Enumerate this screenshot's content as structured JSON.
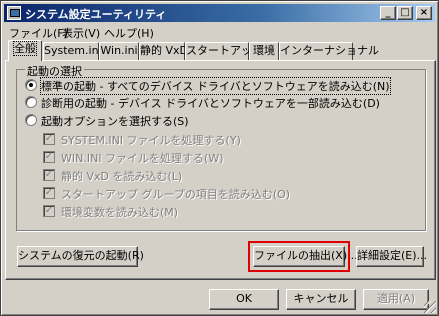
{
  "window": {
    "title": "システム設定ユーティリティ",
    "caption_buttons": {
      "minimize": "_",
      "maximize": "□",
      "close": "×"
    }
  },
  "menubar": [
    {
      "label": "ファイル(F)"
    },
    {
      "label": "表示(V)"
    },
    {
      "label": "ヘルプ(H)"
    }
  ],
  "tabs": [
    {
      "label": "全般",
      "active": true
    },
    {
      "label": "System.ini",
      "active": false
    },
    {
      "label": "Win.ini",
      "active": false
    },
    {
      "label": "静的 VxD",
      "active": false
    },
    {
      "label": "スタートアップ",
      "active": false
    },
    {
      "label": "環境",
      "active": false
    },
    {
      "label": "インターナショナル",
      "active": false
    }
  ],
  "startup_group": {
    "legend": "起動の選択",
    "options": [
      {
        "label": "標準の起動 - すべてのデバイス ドライバとソフトウェアを読み込む(N)",
        "checked": true
      },
      {
        "label": "診断用の起動 - デバイス ドライバとソフトウェアを一部読み込む(D)",
        "checked": false
      },
      {
        "label": "起動オプションを選択する(S)",
        "checked": false
      }
    ],
    "checkboxes": [
      {
        "label": "SYSTEM.INI ファイルを処理する(Y)",
        "checked": true,
        "enabled": false
      },
      {
        "label": "WIN.INI ファイルを処理する(W)",
        "checked": true,
        "enabled": false
      },
      {
        "label": "静的 VxD を読み込む(L)",
        "checked": true,
        "enabled": false
      },
      {
        "label": "スタートアップ グループの項目を読み込む(O)",
        "checked": true,
        "enabled": false
      },
      {
        "label": "環境変数を読み込む(M)",
        "checked": true,
        "enabled": false
      }
    ]
  },
  "panel_buttons": {
    "restore": "システムの復元の起動(R)",
    "extract": "ファイルの抽出(X)...",
    "advanced": "詳細設定(E)..."
  },
  "dialog_buttons": {
    "ok": "OK",
    "cancel": "キャンセル",
    "apply": "適用(A)"
  },
  "colors": {
    "highlight": "#e00000",
    "title_start": "#0a246a",
    "face": "#d4d0c8"
  }
}
